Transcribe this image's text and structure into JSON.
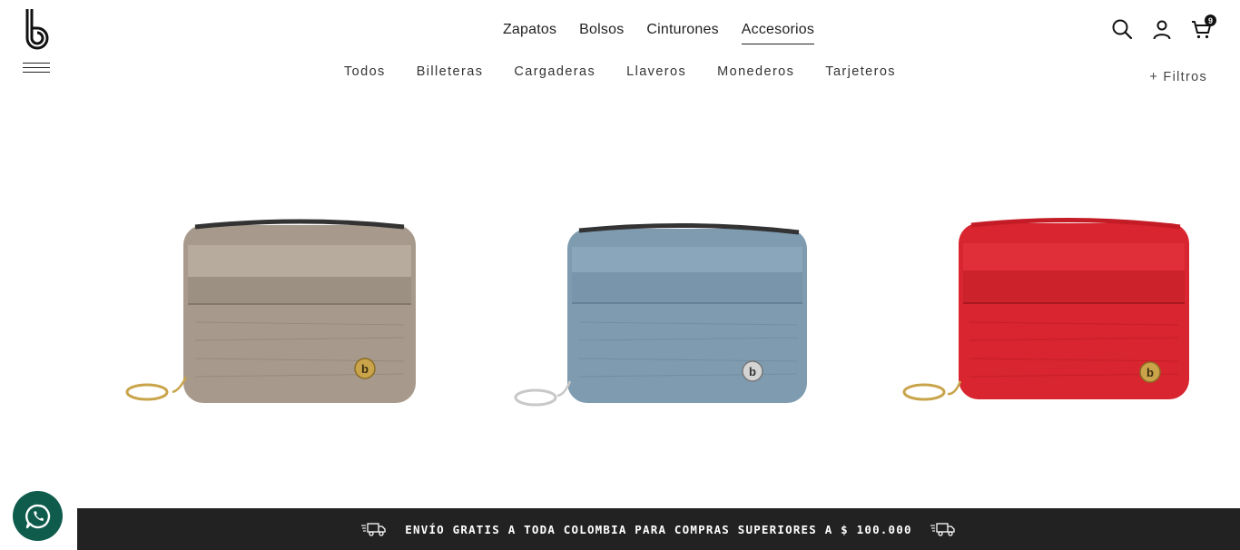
{
  "brand": {
    "logo_icon": "brand-b-logo"
  },
  "main_nav": [
    {
      "label": "Zapatos",
      "active": false
    },
    {
      "label": "Bolsos",
      "active": false
    },
    {
      "label": "Cinturones",
      "active": false
    },
    {
      "label": "Accesorios",
      "active": true
    }
  ],
  "sub_nav": [
    {
      "label": "Todos"
    },
    {
      "label": "Billeteras"
    },
    {
      "label": "Cargaderas"
    },
    {
      "label": "Llaveros"
    },
    {
      "label": "Monederos"
    },
    {
      "label": "Tarjeteros"
    }
  ],
  "header": {
    "search_icon": "search-icon",
    "account_icon": "user-icon",
    "cart_icon": "cart-icon",
    "cart_count": "9",
    "filters_label": "+ Filtros"
  },
  "products": [
    {
      "color_name": "metallic-beige",
      "body_color": "#a79a8c",
      "accent_color": "#8d8073"
    },
    {
      "color_name": "steel-blue",
      "body_color": "#7f9bb0",
      "accent_color": "#6b879b"
    },
    {
      "color_name": "red",
      "body_color": "#d8252f",
      "accent_color": "#b81c25"
    }
  ],
  "promo": {
    "text": "ENVÍO GRATIS A TODA COLOMBIA PARA COMPRAS SUPERIORES A $ 100.000"
  },
  "colors": {
    "promo_bg": "#222222",
    "whatsapp_bg": "#0f5c4d"
  }
}
